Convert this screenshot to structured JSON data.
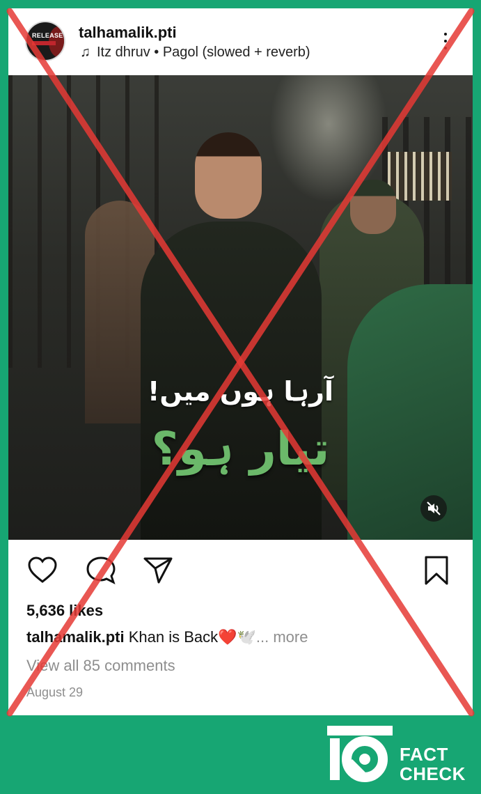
{
  "post": {
    "username": "talhamalik.pti",
    "avatar_text": "RELEASE",
    "music": {
      "icon": "music-note-icon",
      "text": "Itz dhruv • Pagol (slowed + reverb)"
    },
    "image_text_line1": "آرہا ہوں میں!",
    "image_text_line2": "تیار ہو؟",
    "likes": "5,636 likes",
    "caption_user": "talhamalik.pti",
    "caption_text": " Khan is Back",
    "caption_emoji": "❤️🕊️",
    "caption_more": "... more",
    "comments_link": "View all 85 comments",
    "date": "August 29"
  },
  "actions": {
    "like_icon": "heart-icon",
    "comment_icon": "comment-icon",
    "share_icon": "send-icon",
    "save_icon": "bookmark-icon",
    "mute_icon": "mute-icon"
  },
  "overlay": {
    "cross_color": "#e53935",
    "background_color": "#17a673"
  },
  "logo": {
    "word1": "FACT",
    "word2": "CHECK"
  }
}
